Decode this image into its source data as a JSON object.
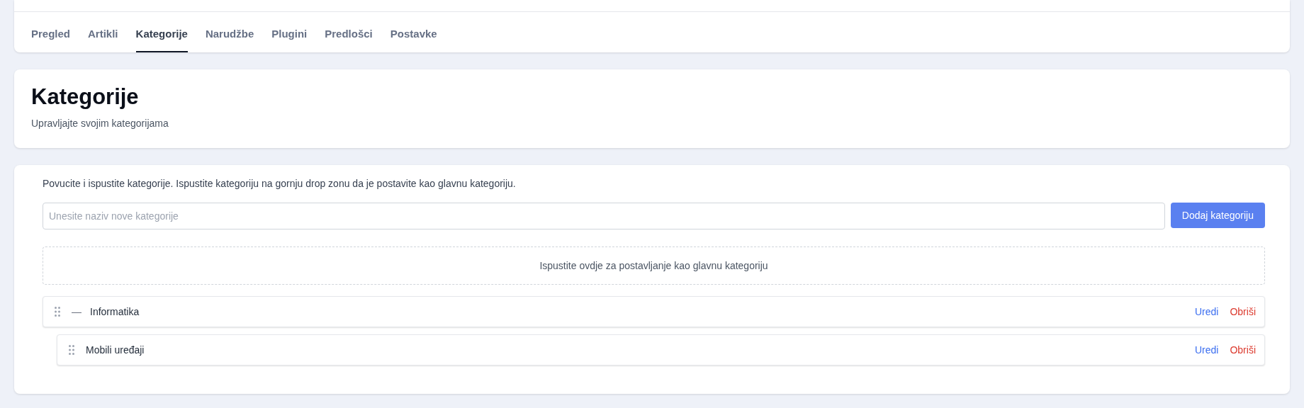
{
  "tabs": [
    {
      "label": "Pregled",
      "selected": false
    },
    {
      "label": "Artikli",
      "selected": false
    },
    {
      "label": "Kategorije",
      "selected": true
    },
    {
      "label": "Narudžbe",
      "selected": false
    },
    {
      "label": "Plugini",
      "selected": false
    },
    {
      "label": "Predlošci",
      "selected": false
    },
    {
      "label": "Postavke",
      "selected": false
    }
  ],
  "header": {
    "title": "Kategorije",
    "subtitle": "Upravljajte svojim kategorijama"
  },
  "instructions": "Povucite i ispustite kategorije. Ispustite kategoriju na gornju drop zonu da je postavite kao glavnu kategoriju.",
  "new_category": {
    "placeholder": "Unesite naziv nove kategorije",
    "button": "Dodaj kategoriju"
  },
  "drop_zone": "Ispustite ovdje za postavljanje kao glavnu kategoriju",
  "categories": [
    {
      "name": "Informatika",
      "expanded": true,
      "toggle": "—",
      "edit": "Uredi",
      "delete": "Obriši",
      "children": [
        {
          "name": "Mobili uređaji",
          "edit": "Uredi",
          "delete": "Obriši"
        }
      ]
    }
  ]
}
